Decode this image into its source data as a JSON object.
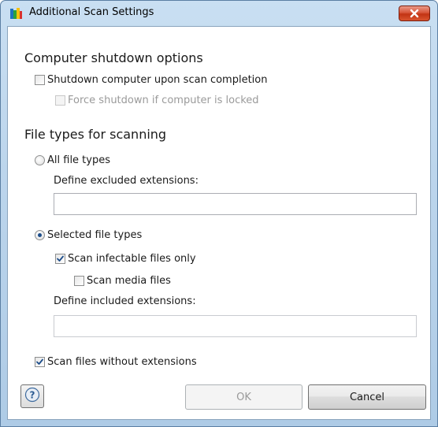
{
  "window": {
    "title": "Additional Scan Settings"
  },
  "shutdown": {
    "heading": "Computer shutdown options",
    "shutdown_label": "Shutdown computer upon scan completion",
    "shutdown_checked": false,
    "force_label": "Force shutdown if computer is locked",
    "force_checked": false,
    "force_enabled": false
  },
  "filetypes": {
    "heading": "File types for scanning",
    "all_label": "All file types",
    "all_selected": false,
    "excluded_label": "Define excluded extensions:",
    "excluded_value": "",
    "selected_label": "Selected file types",
    "selected_selected": true,
    "infectable_label": "Scan infectable files only",
    "infectable_checked": true,
    "media_label": "Scan media files",
    "media_checked": false,
    "included_label": "Define included extensions:",
    "included_value": "",
    "noext_label": "Scan files without extensions",
    "noext_checked": true
  },
  "buttons": {
    "help_glyph": "?",
    "ok_label": "OK",
    "cancel_label": "Cancel"
  },
  "colors": {
    "accent": "#1d4d8a",
    "close_red": "#c23414",
    "disabled_text": "#9a9a9a"
  }
}
